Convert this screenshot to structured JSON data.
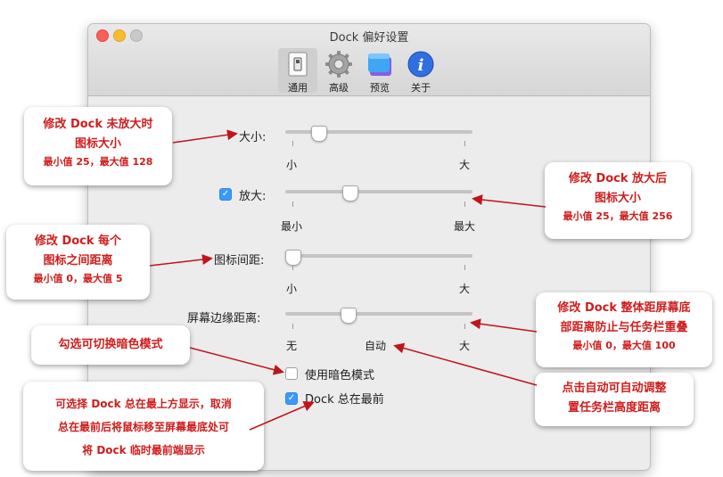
{
  "window": {
    "title": "Dock 偏好设置",
    "toolbar": [
      {
        "label": "通用",
        "icon": "switch-icon"
      },
      {
        "label": "高级",
        "icon": "gear-icon"
      },
      {
        "label": "预览",
        "icon": "preview-icon"
      },
      {
        "label": "关于",
        "icon": "info-icon"
      }
    ]
  },
  "settings": {
    "size": {
      "label": "大小:",
      "min_label": "小",
      "max_label": "大",
      "value_fraction": 0.15
    },
    "magnification": {
      "label": "放大:",
      "checked": true,
      "min_label": "最小",
      "max_label": "最大",
      "value_fraction": 0.33
    },
    "icon_spacing": {
      "label": "图标间距:",
      "min_label": "小",
      "max_label": "大",
      "value_fraction": 0.0
    },
    "screen_edge": {
      "label": "屏幕边缘距离:",
      "left_label": "无",
      "mid_label": "自动",
      "right_label": "大",
      "value_fraction": 0.32
    },
    "dark_mode": {
      "label": "使用暗色模式",
      "checked": false
    },
    "always_on_top": {
      "label": "Dock 总在最前",
      "checked": true
    }
  },
  "callouts": {
    "size": {
      "line1": "修改 Dock 未放大时",
      "line2": "图标大小",
      "sub": "最小值 25，最大值 128"
    },
    "magnify": {
      "line1": "修改 Dock 放大后",
      "line2": "图标大小",
      "sub": "最小值 25，最大值 256"
    },
    "spacing": {
      "line1": "修改 Dock 每个",
      "line2": "图标之间距离",
      "sub": "最小值 0，最大值 5"
    },
    "edge": {
      "line1": "修改 Dock 整体距屏幕底",
      "line2": "部距离防止与任务栏重叠",
      "sub": "最小值 0，最大值 100"
    },
    "dark": {
      "line1": "勾选可切换暗色模式"
    },
    "auto": {
      "line1": "点击自动可自动调整",
      "line2": "置任务栏高度距离"
    },
    "top": {
      "line1": "可选择 Dock 总在最上方显示，取消",
      "line2": "总在最前后将鼠标移至屏幕最底处可",
      "line3": "将 Dock 临时最前端显示"
    }
  },
  "colors": {
    "accent": "#3b99fc",
    "callout_text": "#cf1d1d",
    "arrow": "#c0141b"
  }
}
